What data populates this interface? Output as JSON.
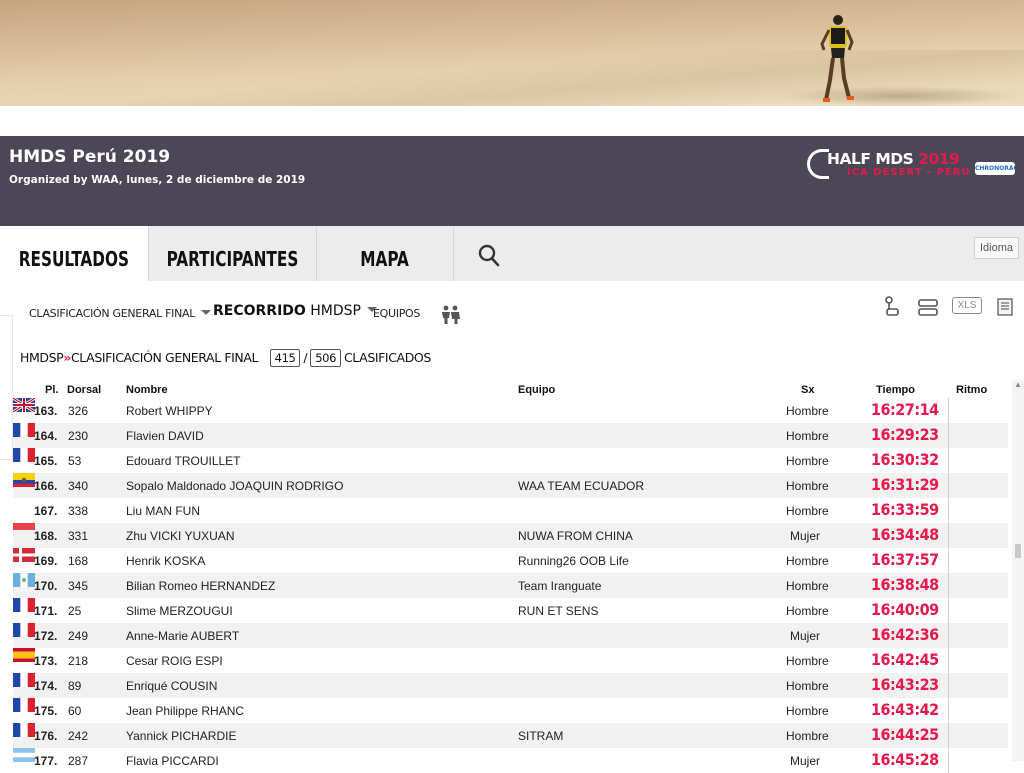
{
  "event": {
    "title": "HMDS Perú 2019",
    "subtitle": "Organized by WAA, lunes, 2 de diciembre de 2019",
    "logo_word": "HALF MDS",
    "logo_year": "2019",
    "logo_sub": "ICA DESERT - PERU",
    "logo_badge": "CHRONORACE"
  },
  "tabs": [
    {
      "label": "RESULTADOS",
      "active": true
    },
    {
      "label": "PARTICIPANTES",
      "active": false
    },
    {
      "label": "MAPA",
      "active": false
    }
  ],
  "idioma_label": "Idioma",
  "filters": {
    "clasificacion": "CLASIFICACIÓN GENERAL FINAL",
    "recorrido_label": "RECORRIDO",
    "recorrido_value": "HMDSP",
    "equipos": "EQUIPOS",
    "xls": "XLS"
  },
  "breadcrumb": {
    "course": "HMDSP",
    "sep": "»",
    "classification": "CLASIFICACIÓN GENERAL FINAL",
    "shown": "415",
    "slash": "/",
    "total": "506",
    "suffix": "CLASIFICADOS"
  },
  "table": {
    "headers": {
      "pl": "Pl.",
      "dorsal": "Dorsal",
      "nombre": "Nombre",
      "equipo": "Equipo",
      "sx": "Sx",
      "tiempo": "Tiempo",
      "ritmo": "Ritmo"
    },
    "rows": [
      {
        "pl": "163.",
        "dorsal": "326",
        "nombre": "Robert WHIPPY",
        "flag": "gb",
        "equipo": "",
        "sx": "Hombre",
        "tiempo": "16:27:14"
      },
      {
        "pl": "164.",
        "dorsal": "230",
        "nombre": "Flavien DAVID",
        "flag": "fr",
        "equipo": "",
        "sx": "Hombre",
        "tiempo": "16:29:23"
      },
      {
        "pl": "165.",
        "dorsal": "53",
        "nombre": "Edouard TROUILLET",
        "flag": "fr",
        "equipo": "",
        "sx": "Hombre",
        "tiempo": "16:30:32"
      },
      {
        "pl": "166.",
        "dorsal": "340",
        "nombre": "Sopalo Maldonado JOAQUIN RODRIGO",
        "flag": "ec",
        "equipo": "WAA TEAM ECUADOR",
        "sx": "Hombre",
        "tiempo": "16:31:29"
      },
      {
        "pl": "167.",
        "dorsal": "338",
        "nombre": "Liu MAN FUN",
        "flag": "",
        "equipo": "",
        "sx": "Hombre",
        "tiempo": "16:33:59"
      },
      {
        "pl": "168.",
        "dorsal": "331",
        "nombre": "Zhu VICKI YUXUAN",
        "flag": "sg",
        "equipo": "NUWA FROM CHINA",
        "sx": "Mujer",
        "tiempo": "16:34:48"
      },
      {
        "pl": "169.",
        "dorsal": "168",
        "nombre": "Henrik KOSKA",
        "flag": "dk",
        "equipo": "Running26 OOB Life",
        "sx": "Hombre",
        "tiempo": "16:37:57"
      },
      {
        "pl": "170.",
        "dorsal": "345",
        "nombre": "Bilian Romeo HERNANDEZ",
        "flag": "gt",
        "equipo": "Team Iranguate",
        "sx": "Hombre",
        "tiempo": "16:38:48"
      },
      {
        "pl": "171.",
        "dorsal": "25",
        "nombre": "Slime MERZOUGUI",
        "flag": "fr",
        "equipo": "RUN ET SENS",
        "sx": "Hombre",
        "tiempo": "16:40:09"
      },
      {
        "pl": "172.",
        "dorsal": "249",
        "nombre": "Anne-Marie AUBERT",
        "flag": "fr",
        "equipo": "",
        "sx": "Mujer",
        "tiempo": "16:42:36"
      },
      {
        "pl": "173.",
        "dorsal": "218",
        "nombre": "Cesar ROIG ESPI",
        "flag": "es",
        "equipo": "",
        "sx": "Hombre",
        "tiempo": "16:42:45"
      },
      {
        "pl": "174.",
        "dorsal": "89",
        "nombre": "Enriqué COUSIN",
        "flag": "fr",
        "equipo": "",
        "sx": "Hombre",
        "tiempo": "16:43:23"
      },
      {
        "pl": "175.",
        "dorsal": "60",
        "nombre": "Jean Philippe RHANC",
        "flag": "fr",
        "equipo": "",
        "sx": "Hombre",
        "tiempo": "16:43:42"
      },
      {
        "pl": "176.",
        "dorsal": "242",
        "nombre": "Yannick PICHARDIE",
        "flag": "fr",
        "equipo": "SITRAM",
        "sx": "Hombre",
        "tiempo": "16:44:25"
      },
      {
        "pl": "177.",
        "dorsal": "287",
        "nombre": "Flavia PICCARDI",
        "flag": "ar",
        "equipo": "",
        "sx": "Mujer",
        "tiempo": "16:45:28"
      }
    ]
  },
  "colors": {
    "accent": "#e5194b",
    "header_bg": "#4c4757",
    "tab_bar_bg": "#ececec"
  }
}
